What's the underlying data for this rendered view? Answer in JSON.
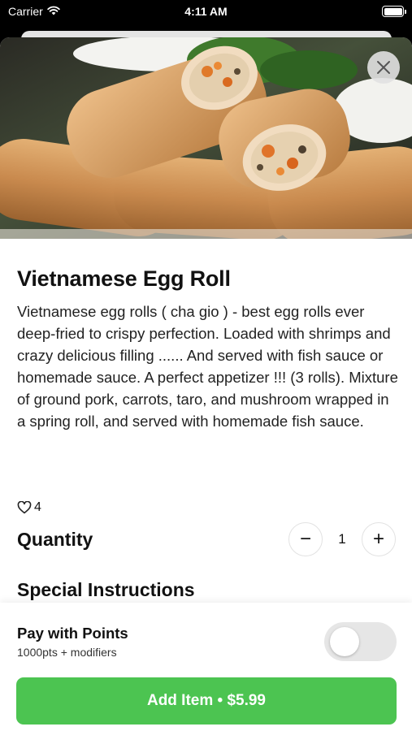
{
  "status_bar": {
    "carrier": "Carrier",
    "time": "4:11 AM"
  },
  "item": {
    "title": "Vietnamese Egg Roll",
    "description": "Vietnamese egg rolls ( cha gio ) - best egg rolls ever deep-fried to crispy perfection. Loaded with shrimps and crazy delicious filling ...... And served with fish sauce or homemade sauce. A perfect appetizer !!! (3 rolls). Mixture of ground pork, carrots, taro, and mushroom wrapped in a spring roll, and served with homemade fish sauce.",
    "likes": "4"
  },
  "quantity": {
    "label": "Quantity",
    "value": "1",
    "minus": "−",
    "plus": "+"
  },
  "special_instructions": {
    "label": "Special Instructions"
  },
  "points": {
    "title": "Pay with Points",
    "subtitle": "1000pts + modifiers",
    "enabled": false
  },
  "add_button": {
    "label": "Add Item • $5.99"
  },
  "colors": {
    "accent_green": "#4cc451",
    "toggle_off": "#e6e6e6"
  },
  "icons": {
    "close": "close-icon",
    "heart": "heart-icon",
    "wifi": "wifi-icon",
    "battery": "battery-icon"
  }
}
